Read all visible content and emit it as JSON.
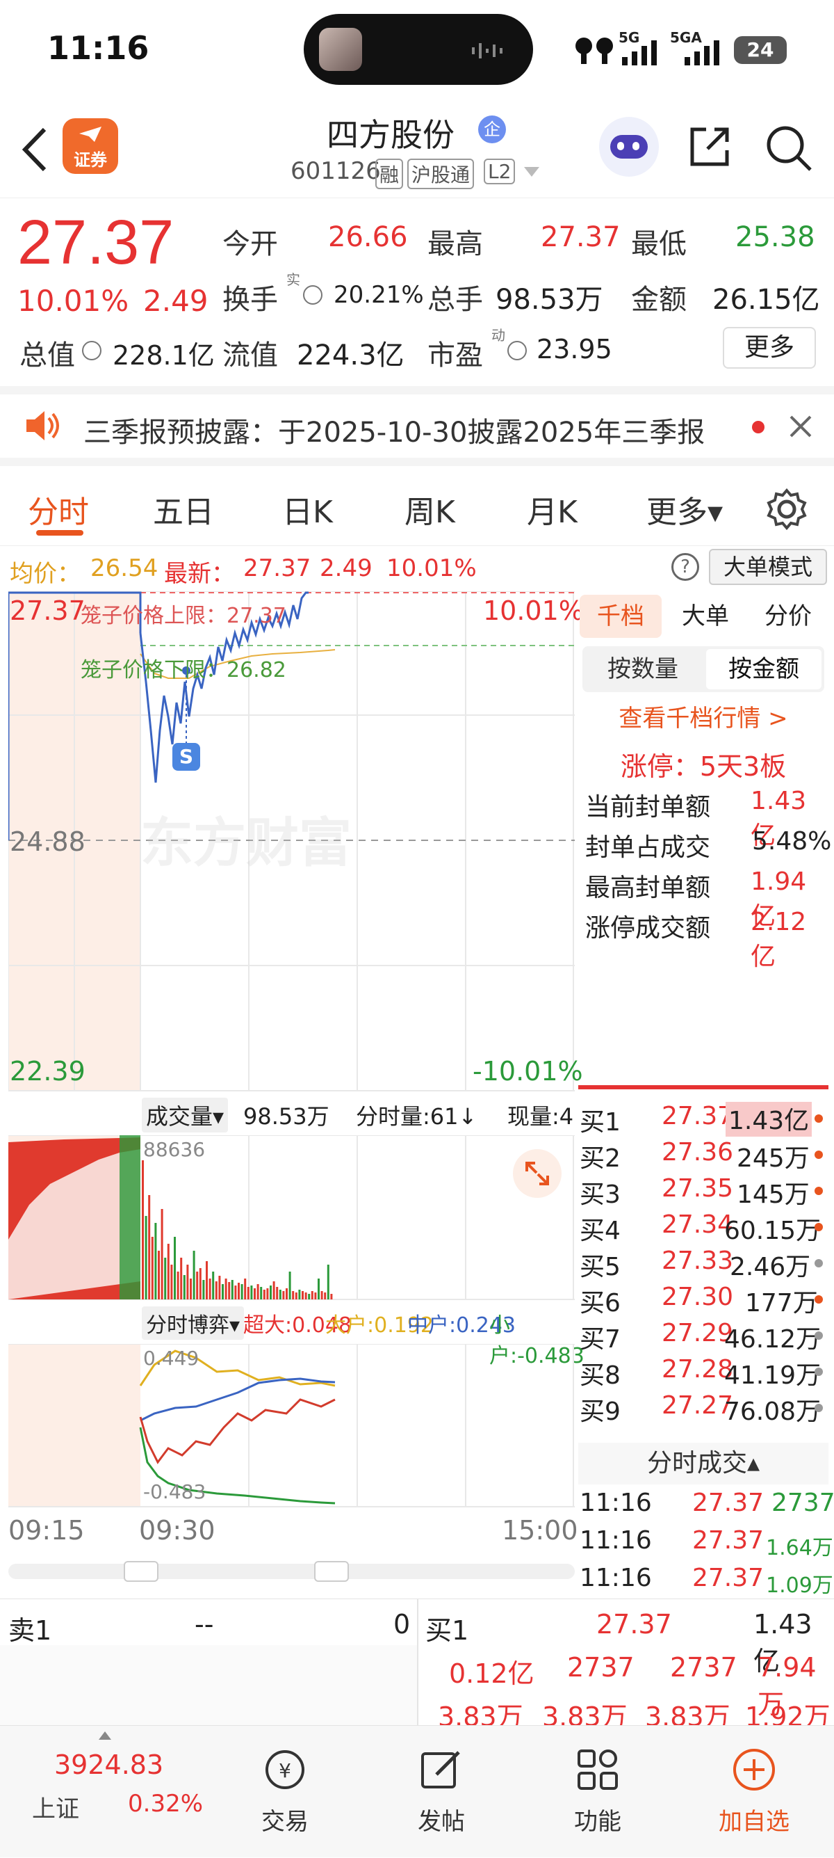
{
  "status": {
    "time": "11:16",
    "signal1": "5G",
    "signal2": "5GA",
    "battery": "24"
  },
  "header": {
    "title": "四方股份",
    "title_badge": "企",
    "code": "601126",
    "tags": [
      "融",
      "沪股通",
      "L2"
    ],
    "broker_badge": "证券"
  },
  "quote": {
    "price": "27.37",
    "change_pct": "10.01%",
    "change": "2.49",
    "open_label": "今开",
    "open": "26.66",
    "high_label": "最高",
    "high": "27.37",
    "low_label": "最低",
    "low": "25.38",
    "turnover_label": "换手",
    "turnover_sup": "实",
    "turnover": "20.21%",
    "volume_label": "总手",
    "volume": "98.53万",
    "amount_label": "金额",
    "amount": "26.15亿",
    "mcap_label": "总值",
    "mcap": "228.1亿",
    "float_label": "流值",
    "float": "224.3亿",
    "pe_label": "市盈",
    "pe_sup": "动",
    "pe": "23.95",
    "more_btn": "更多"
  },
  "notice": {
    "text": "三季报预披露：于2025-10-30披露2025年三季报"
  },
  "tabs": [
    {
      "label": "分时",
      "active": true
    },
    {
      "label": "五日"
    },
    {
      "label": "日K"
    },
    {
      "label": "周K"
    },
    {
      "label": "月K"
    },
    {
      "label": "更多▾"
    }
  ],
  "legend": {
    "avg_label": "均价：",
    "avg": "26.54",
    "latest_label": "最新：",
    "latest": "27.37",
    "chg": "2.49",
    "pct": "10.01%",
    "mode_btn": "大单模式",
    "help": "?"
  },
  "chart": {
    "y_top": "27.37",
    "y_mid": "24.88",
    "y_bot": "22.39",
    "pct_top": "10.01%",
    "pct_bot": "-10.01%",
    "upper_limit": "笼子价格上限：27.37",
    "lower_limit": "笼子价格下限：26.82",
    "watermark": "东方财富",
    "marker": "S",
    "vol_label": "成交量▾",
    "vol_value": "98.53万",
    "vol_minute": "分时量:61↓",
    "vol_now": "现量:4",
    "vol_max": "88636",
    "game_label": "分时博弈▾",
    "game_super": "超大:0.048",
    "game_large": "大户:0.192",
    "game_mid": "中户:0.243",
    "game_small": "小户:-0.483",
    "game_top": "0.449",
    "game_bot": "-0.483",
    "times": [
      "09:15",
      "09:30",
      "15:00"
    ]
  },
  "right": {
    "tabs": [
      "千档",
      "大单",
      "分价"
    ],
    "sub_tabs": [
      "按数量",
      "按金额"
    ],
    "link": "查看千档行情 >",
    "limit_title": "涨停：5天3板",
    "stats": [
      {
        "label": "当前封单额",
        "value": "1.43亿"
      },
      {
        "label": "封单占成交",
        "value": "5.48%"
      },
      {
        "label": "最高封单额",
        "value": "1.94亿"
      },
      {
        "label": "涨停成交额",
        "value": "2.12亿"
      }
    ],
    "bids": [
      {
        "name": "买1",
        "price": "27.37",
        "vol": "1.43亿"
      },
      {
        "name": "买2",
        "price": "27.36",
        "vol": "245万"
      },
      {
        "name": "买3",
        "price": "27.35",
        "vol": "145万"
      },
      {
        "name": "买4",
        "price": "27.34",
        "vol": "60.15万"
      },
      {
        "name": "买5",
        "price": "27.33",
        "vol": "2.46万"
      },
      {
        "name": "买6",
        "price": "27.30",
        "vol": "177万"
      },
      {
        "name": "买7",
        "price": "27.29",
        "vol": "46.12万"
      },
      {
        "name": "买8",
        "price": "27.28",
        "vol": "41.19万"
      },
      {
        "name": "买9",
        "price": "27.27",
        "vol": "76.08万"
      }
    ],
    "ticks_title": "分时成交▴",
    "ticks": [
      {
        "time": "11:16",
        "price": "27.37",
        "vol": "2737"
      },
      {
        "time": "11:16",
        "price": "27.37",
        "vol": "1.64万"
      },
      {
        "time": "11:16",
        "price": "27.37",
        "vol": "1.09万"
      }
    ]
  },
  "bottom": {
    "sell1_label": "卖1",
    "sell1_price": "--",
    "sell1_vol": "0",
    "buy1_label": "买1",
    "buy1_price": "27.37",
    "buy1_vol": "1.43亿",
    "row2": [
      "0.12亿",
      "2737",
      "2737",
      "7.94万"
    ],
    "row3": [
      "3.83万",
      "3.83万",
      "3.83万",
      "1.92万"
    ]
  },
  "nav": {
    "index_value": "3924.83",
    "index_name": "上证",
    "index_pct": "0.32%",
    "items": [
      "交易",
      "发帖",
      "功能",
      "加自选"
    ]
  }
}
